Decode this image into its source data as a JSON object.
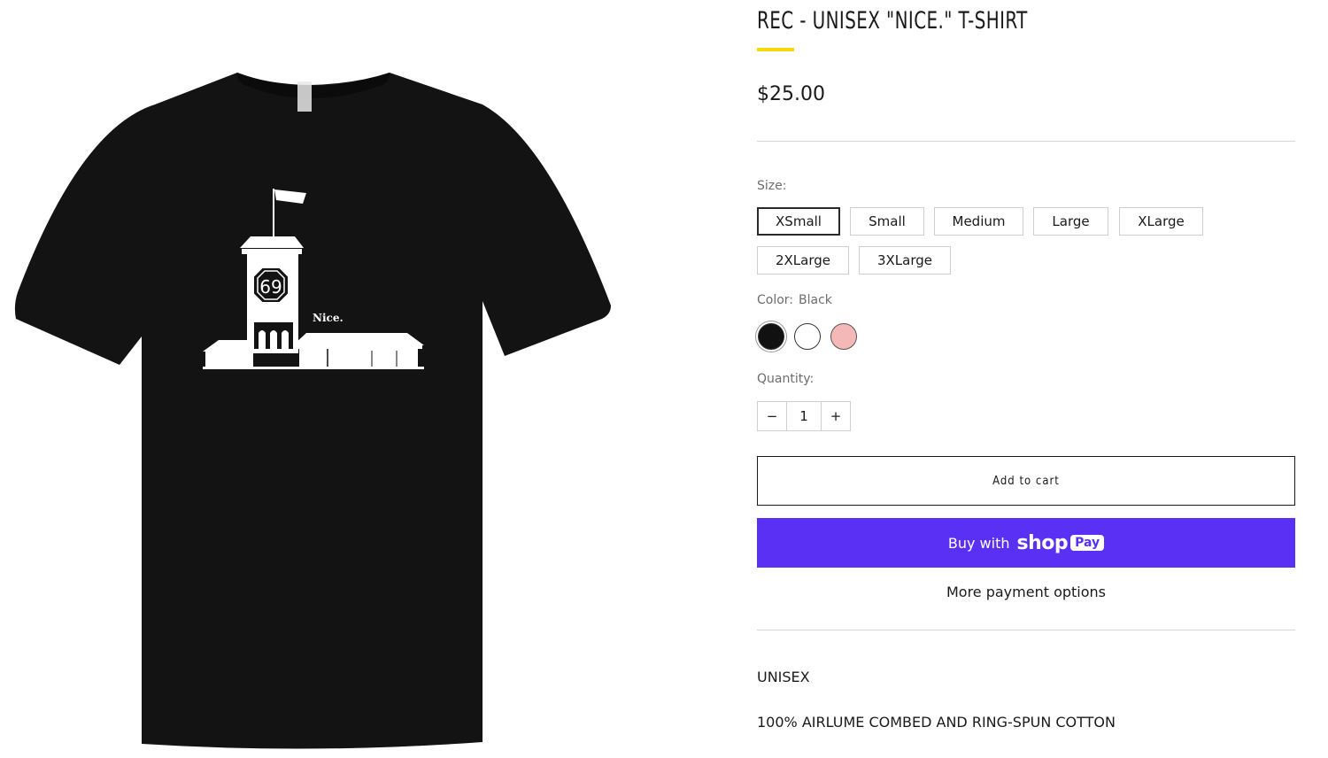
{
  "product": {
    "title": "REC - UNISEX \"NICE.\" T-SHIRT",
    "price": "$25.00",
    "image_alt": "Black t-shirt with white clock tower illustration",
    "print_text": "Nice.",
    "print_number": "69",
    "accent_color": "#f6d60c"
  },
  "options": {
    "size_label": "Size:",
    "sizes": [
      "XSmall",
      "Small",
      "Medium",
      "Large",
      "XLarge",
      "2XLarge",
      "3XLarge"
    ],
    "selected_size": "XSmall",
    "color_label": "Color:",
    "color_value": "Black",
    "colors": [
      {
        "name": "Black",
        "hex": "#111111"
      },
      {
        "name": "White",
        "hex": "#ffffff"
      },
      {
        "name": "Pink",
        "hex": "#f4b8b6"
      }
    ]
  },
  "quantity": {
    "label": "Quantity:",
    "minus": "−",
    "value": "1",
    "plus": "+"
  },
  "actions": {
    "add_to_cart": "Add to cart",
    "buy_with": "Buy with",
    "shop_word": "shop",
    "pay_word": "Pay",
    "shop_pay_color": "#5a31f4",
    "more_payment": "More payment options"
  },
  "description": {
    "line1": "UNISEX",
    "line2": "100% AIRLUME COMBED AND RING-SPUN COTTON"
  }
}
